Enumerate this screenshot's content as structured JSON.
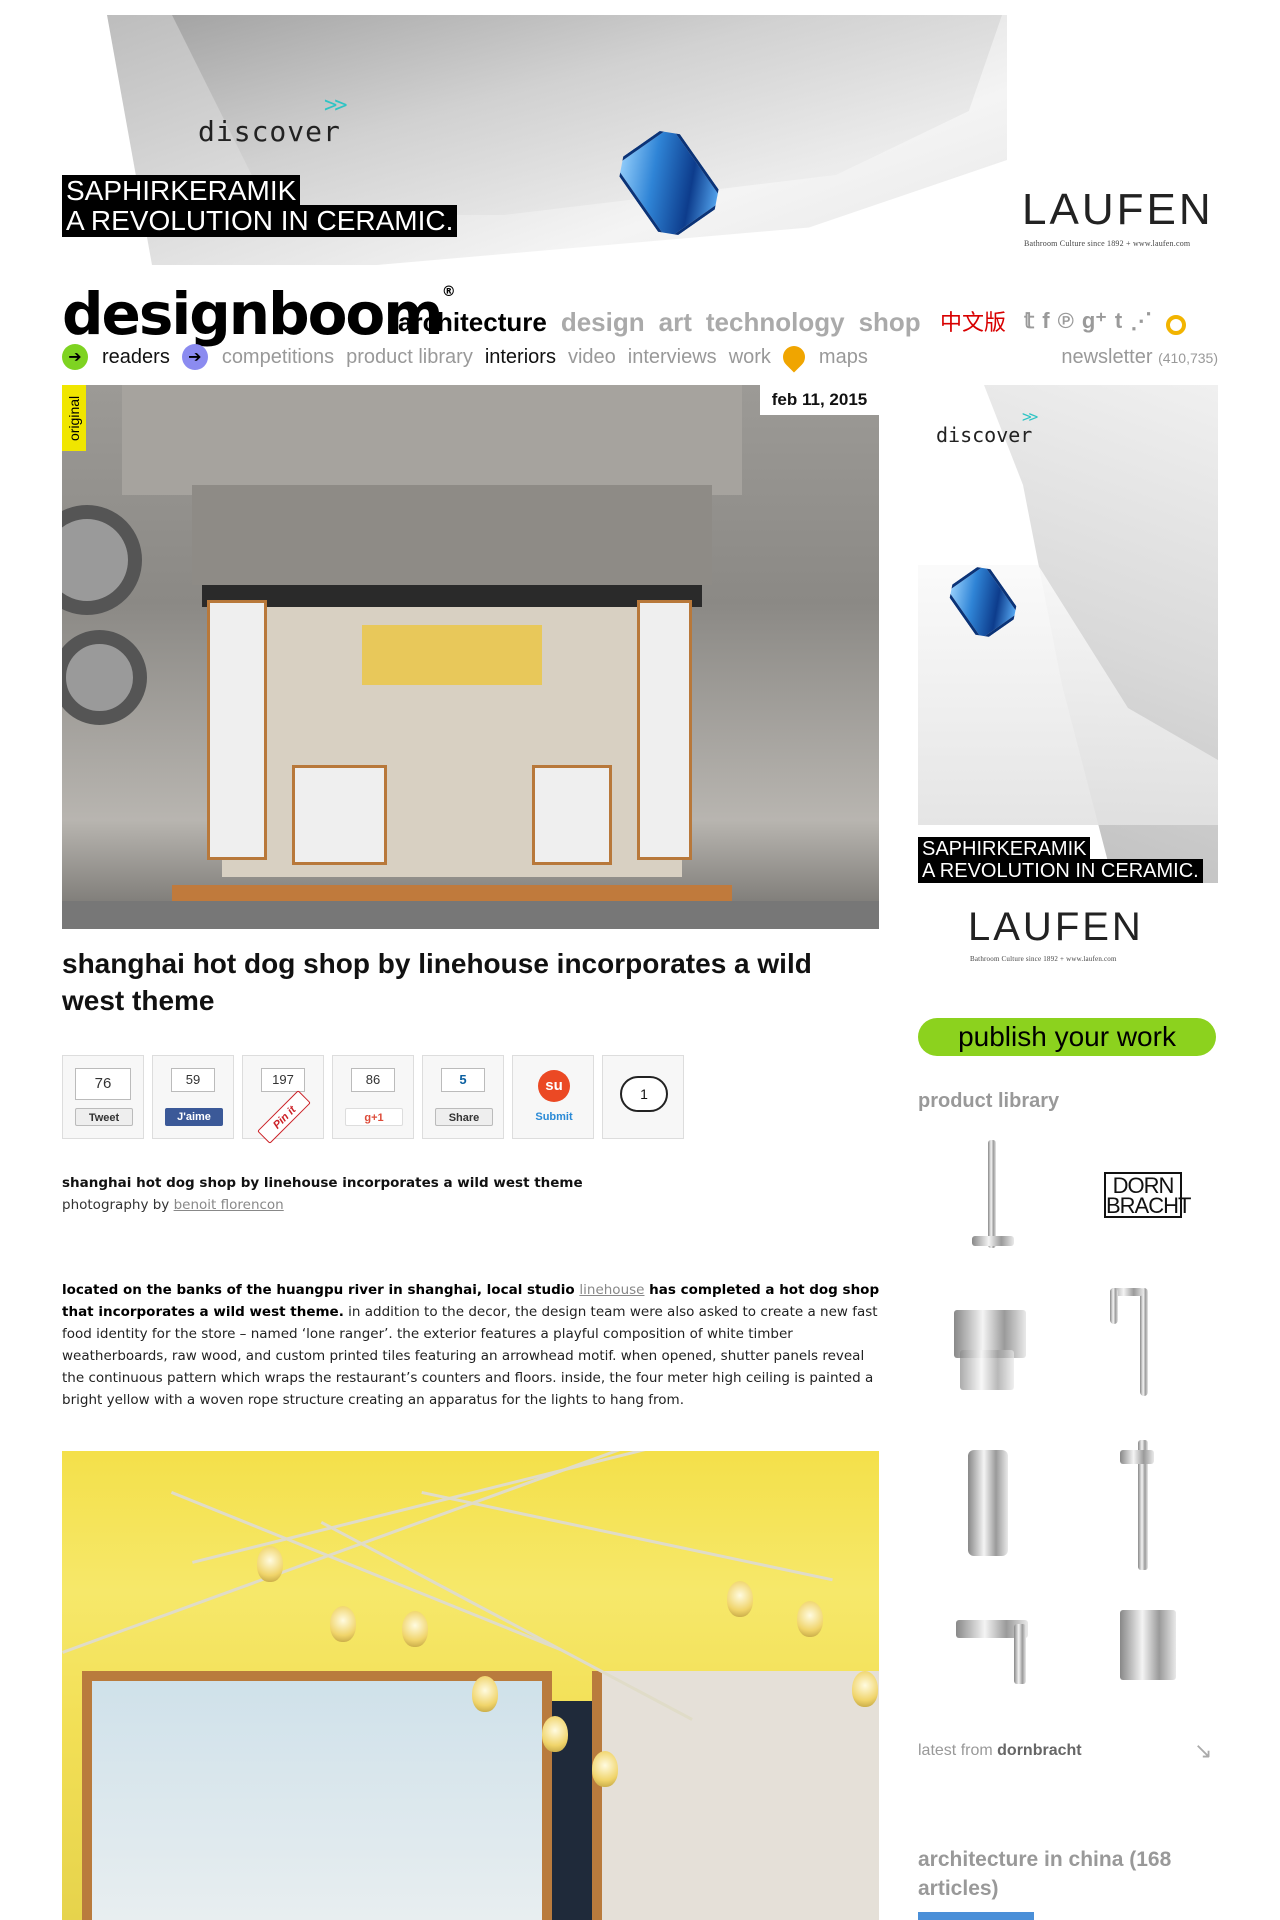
{
  "banner_ad": {
    "discover": "discover",
    "chevrons": ">>",
    "tagline_1": "SAPHIRKERAMIK",
    "tagline_2": "A REVOLUTION IN CERAMIC.",
    "brand": "LAUFEN",
    "brand_sub": "Bathroom Culture since 1892 + www.laufen.com"
  },
  "header": {
    "logo": "designboom",
    "logo_mark": "®",
    "sections": [
      {
        "label": "architecture",
        "active": true
      },
      {
        "label": "design",
        "active": false
      },
      {
        "label": "art",
        "active": false
      },
      {
        "label": "technology",
        "active": false
      },
      {
        "label": "shop",
        "active": false
      }
    ],
    "chinese_edition": "中文版",
    "social_icons": [
      "twitter-icon",
      "facebook-icon",
      "pinterest-icon",
      "google-plus-icon",
      "tumblr-icon",
      "rss-icon",
      "search-icon"
    ]
  },
  "subnav": {
    "readers": "readers",
    "competitions": "competitions",
    "product_library": "product library",
    "interiors": "interiors",
    "video": "video",
    "interviews": "interviews",
    "work": "work",
    "maps": "maps",
    "newsletter": "newsletter",
    "newsletter_count": "(410,735)"
  },
  "article": {
    "label_original": "original",
    "date": "feb 11, 2015",
    "title": "shanghai hot dog shop by linehouse incorporates a wild west theme",
    "caption_title": "shanghai hot dog shop by linehouse incorporates a wild west theme",
    "caption_photo_prefix": "photography by ",
    "caption_photographer": "benoit florencon",
    "body_intro_1": "located on the banks of the huangpu river in shanghai, local studio ",
    "body_link": "linehouse",
    "body_intro_2": " has completed a hot dog shop that incorporates a wild west theme.",
    "body_rest": " in addition to the decor, the design team were also asked to create a new fast food identity for the store – named ‘lone ranger’. the exterior features a playful composition of white timber weatherboards, raw wood, and custom printed tiles featuring an arrowhead motif. when opened, shutter panels reveal the continuous pattern which wraps the restaurant’s counters and floors. inside, the four meter high ceiling is painted a bright yellow with a woven rope structure creating an apparatus for the lights to hang from."
  },
  "shares": {
    "tweet_count": "76",
    "tweet_label": "Tweet",
    "fb_count": "59",
    "fb_label": "J'aime",
    "pin_count": "197",
    "pin_label": "Pin it",
    "gplus_count": "86",
    "gplus_label": "g+1",
    "linkedin_count": "5",
    "linkedin_label": "Share",
    "stumble_label": "Submit",
    "comments_count": "1"
  },
  "sidebar": {
    "ad_discover": "discover",
    "ad_chevrons": ">>",
    "ad_tagline_1": "SAPHIRKERAMIK",
    "ad_tagline_2": "A REVOLUTION IN CERAMIC.",
    "ad_brand": "LAUFEN",
    "ad_brand_sub": "Bathroom Culture since 1892 + www.laufen.com",
    "publish_button": "publish your work",
    "product_library_heading": "product library",
    "dornbracht_line_1": "DORN",
    "dornbracht_line_2": "BRACHT",
    "latest_prefix": "latest from ",
    "latest_brand": "dornbracht",
    "architecture_heading": "architecture in china (168 articles)"
  }
}
